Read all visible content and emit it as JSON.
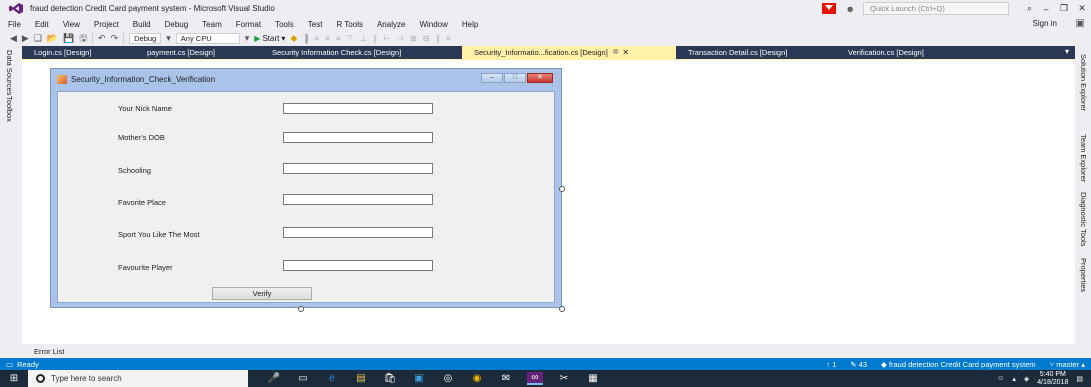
{
  "window": {
    "title": "fraud detection Credit Card payment system - Microsoft Visual Studio",
    "quick_launch_placeholder": "Quick Launch (Ctrl+Q)"
  },
  "menu": {
    "items": [
      "File",
      "Edit",
      "View",
      "Project",
      "Build",
      "Debug",
      "Team",
      "Format",
      "Tools",
      "Test",
      "R Tools",
      "Analyze",
      "Window",
      "Help"
    ],
    "signin": "Sign in"
  },
  "toolbar": {
    "config": "Debug",
    "platform": "Any CPU",
    "start": "Start"
  },
  "left_strip": {
    "data_sources": "Data Sources",
    "toolbox": "Toolbox"
  },
  "right_strip": {
    "solution_explorer": "Solution Explorer",
    "team_explorer": "Team Explorer",
    "diagnostic_tools": "Diagnostic Tools",
    "properties": "Properties"
  },
  "tabs": [
    {
      "label": "Login.cs [Design]"
    },
    {
      "label": "payment.cs [Design]"
    },
    {
      "label": "Security Information Check.cs [Design]"
    },
    {
      "label": "Security_Informatio...fication.cs [Design]",
      "active": true
    },
    {
      "label": "Transaction Detail.cs [Design]"
    },
    {
      "label": "Verification.cs [Design]"
    }
  ],
  "form": {
    "title": "Security_Information_Check_Verification",
    "fields": [
      {
        "label": "Your Nick Name",
        "value": ""
      },
      {
        "label": "Mother's DOB",
        "value": ""
      },
      {
        "label": "Schooling",
        "value": ""
      },
      {
        "label": "Favorite Place",
        "value": ""
      },
      {
        "label": "Sport You Like The Most",
        "value": ""
      },
      {
        "label": "Favourite Player",
        "value": ""
      }
    ],
    "verify_button": "Verify"
  },
  "bottom": {
    "error_list": "Error List"
  },
  "status": {
    "ready": "Ready",
    "up_count": "1",
    "edit_count": "43",
    "project": "fraud detection Credit Card payment system",
    "branch": "master"
  },
  "taskbar": {
    "search_placeholder": "Type here to search",
    "time": "5:40 PM",
    "date": "4/18/2018"
  },
  "colors": {
    "tab_strip": "#293955",
    "active_tab": "#fff1a8",
    "status_bar": "#007acc",
    "taskbar": "#1c2b3a",
    "form_frame": "#a9c4e8"
  }
}
